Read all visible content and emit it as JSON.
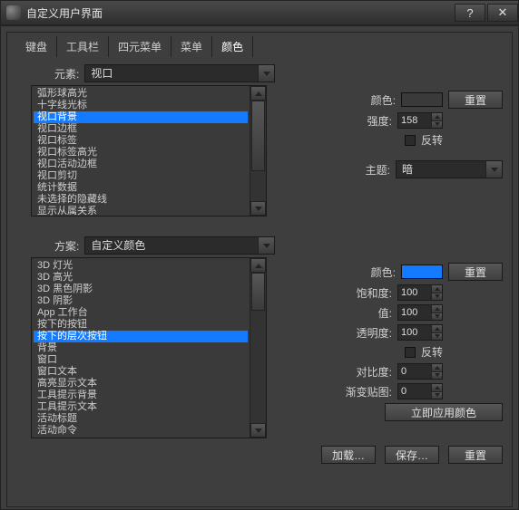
{
  "title": "自定义用户界面",
  "tabs": [
    "键盘",
    "工具栏",
    "四元菜单",
    "菜单",
    "颜色"
  ],
  "active_tab": 4,
  "section1": {
    "label_element": "元素:",
    "combo_value": "视口",
    "list": [
      "弧形球高光",
      "十字线光标",
      "视口背景",
      "视口边框",
      "视口标签",
      "视口标签高光",
      "视口活动边框",
      "视口剪切",
      "统计数据",
      "未选择的隐藏线",
      "显示从属关系"
    ],
    "selected_index": 2,
    "right": {
      "color_label": "颜色:",
      "color_value": "#3a3a3a",
      "reset_label": "重置",
      "intensity_label": "强度:",
      "intensity_value": "158",
      "invert_label": "反转",
      "theme_label": "主题:",
      "theme_value": "暗"
    }
  },
  "section2": {
    "label_scheme": "方案:",
    "combo_value": "自定义颜色",
    "list": [
      "3D 灯光",
      "3D 高光",
      "3D 黑色阴影",
      "3D 阴影",
      "App 工作台",
      "按下的按钮",
      "按下的层次按钮",
      "背景",
      "窗口",
      "窗口文本",
      "高亮显示文本",
      "工具提示背景",
      "工具提示文本",
      "活动标题",
      "活动命令"
    ],
    "selected_index": 6,
    "right": {
      "color_label": "颜色:",
      "color_value": "#147aff",
      "reset_label": "重置",
      "saturation_label": "饱和度:",
      "saturation_value": "100",
      "value_label": "值:",
      "value_value": "100",
      "opacity_label": "透明度:",
      "opacity_value": "100",
      "invert_label": "反转",
      "contrast_label": "对比度:",
      "contrast_value": "0",
      "gradient_label": "渐变贴图:",
      "gradient_value": "0",
      "apply_now": "立即应用颜色"
    }
  },
  "bottom": {
    "load": "加载…",
    "save": "保存…",
    "reset": "重置"
  }
}
